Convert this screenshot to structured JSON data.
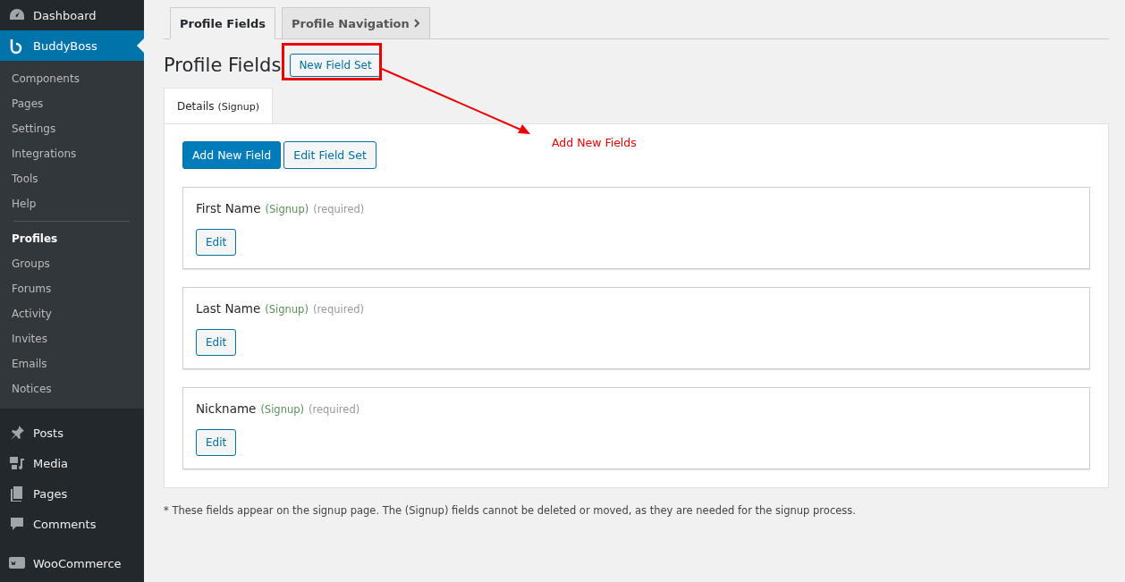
{
  "sidebar": {
    "groups": [
      [
        {
          "label": "Dashboard",
          "selected": false
        },
        {
          "label": "BuddyBoss",
          "selected": true,
          "submenu": [
            [
              {
                "label": "Components",
                "selected": false
              },
              {
                "label": "Pages",
                "selected": false
              },
              {
                "label": "Settings",
                "selected": false
              },
              {
                "label": "Integrations",
                "selected": false
              },
              {
                "label": "Tools",
                "selected": false
              },
              {
                "label": "Help",
                "selected": false
              }
            ],
            [
              {
                "label": "Profiles",
                "selected": true
              },
              {
                "label": "Groups",
                "selected": false
              },
              {
                "label": "Forums",
                "selected": false
              },
              {
                "label": "Activity",
                "selected": false
              },
              {
                "label": "Invites",
                "selected": false
              },
              {
                "label": "Emails",
                "selected": false
              },
              {
                "label": "Notices",
                "selected": false
              }
            ]
          ]
        }
      ],
      [
        {
          "label": "Posts",
          "selected": false
        },
        {
          "label": "Media",
          "selected": false
        },
        {
          "label": "Pages",
          "selected": false
        },
        {
          "label": "Comments",
          "selected": false
        }
      ],
      [
        {
          "label": "WooCommerce",
          "selected": false
        }
      ]
    ]
  },
  "tabs": [
    {
      "label": "Profile Fields",
      "selected": true
    },
    {
      "label": "Profile Navigation",
      "selected": false
    }
  ],
  "heading": "Profile Fields",
  "heading_button": "New Field Set",
  "annotation": {
    "label": "Add New Fields"
  },
  "field_set_tabs": [
    {
      "label": "Details",
      "tag": "(Signup)",
      "selected": true
    }
  ],
  "actions": [
    {
      "label": "Add New Field",
      "kind": "primary"
    },
    {
      "label": "Edit Field Set",
      "kind": "secondary"
    }
  ],
  "fields": [
    {
      "name": "First Name",
      "tag": "(Signup)",
      "note": "(required)",
      "button": "Edit"
    },
    {
      "name": "Last Name",
      "tag": "(Signup)",
      "note": "(required)",
      "button": "Edit"
    },
    {
      "name": "Nickname",
      "tag": "(Signup)",
      "note": "(required)",
      "button": "Edit"
    }
  ],
  "footnote": "* These fields appear on the signup page. The (Signup) fields cannot be deleted or moved, as they are needed for the signup process."
}
